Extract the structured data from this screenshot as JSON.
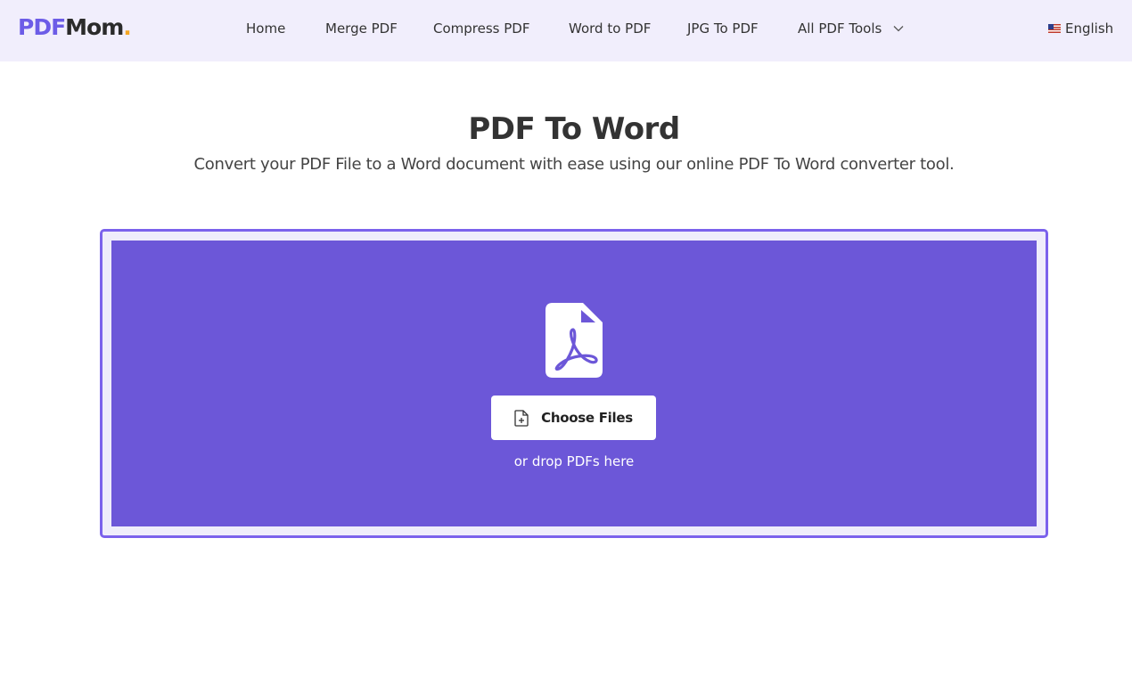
{
  "header": {
    "logo": {
      "part1": "PDF",
      "part2": "Mom",
      "dot": "."
    },
    "nav": [
      {
        "label": "Home"
      },
      {
        "label": "Merge PDF"
      },
      {
        "label": "Compress PDF"
      },
      {
        "label": "Word to PDF"
      },
      {
        "label": "JPG To PDF"
      },
      {
        "label": "All PDF Tools",
        "icon": "chevron-down-icon"
      }
    ],
    "language": {
      "label": "English",
      "icon": "us-flag-icon"
    }
  },
  "main": {
    "title": "PDF To Word",
    "subtitle": "Convert your PDF File to a Word document with ease using our online PDF To Word converter tool."
  },
  "upload": {
    "icon": "pdf-file-icon",
    "button_label": "Choose Files",
    "button_icon": "file-add-icon",
    "drop_hint": "or drop PDFs here"
  },
  "colors": {
    "accent": "#6c5ce7",
    "drop_zone": "#6c57d8",
    "drop_border": "#7b62ec",
    "header_bg": "#f1eefc",
    "logo_dot": "#f5a623"
  }
}
